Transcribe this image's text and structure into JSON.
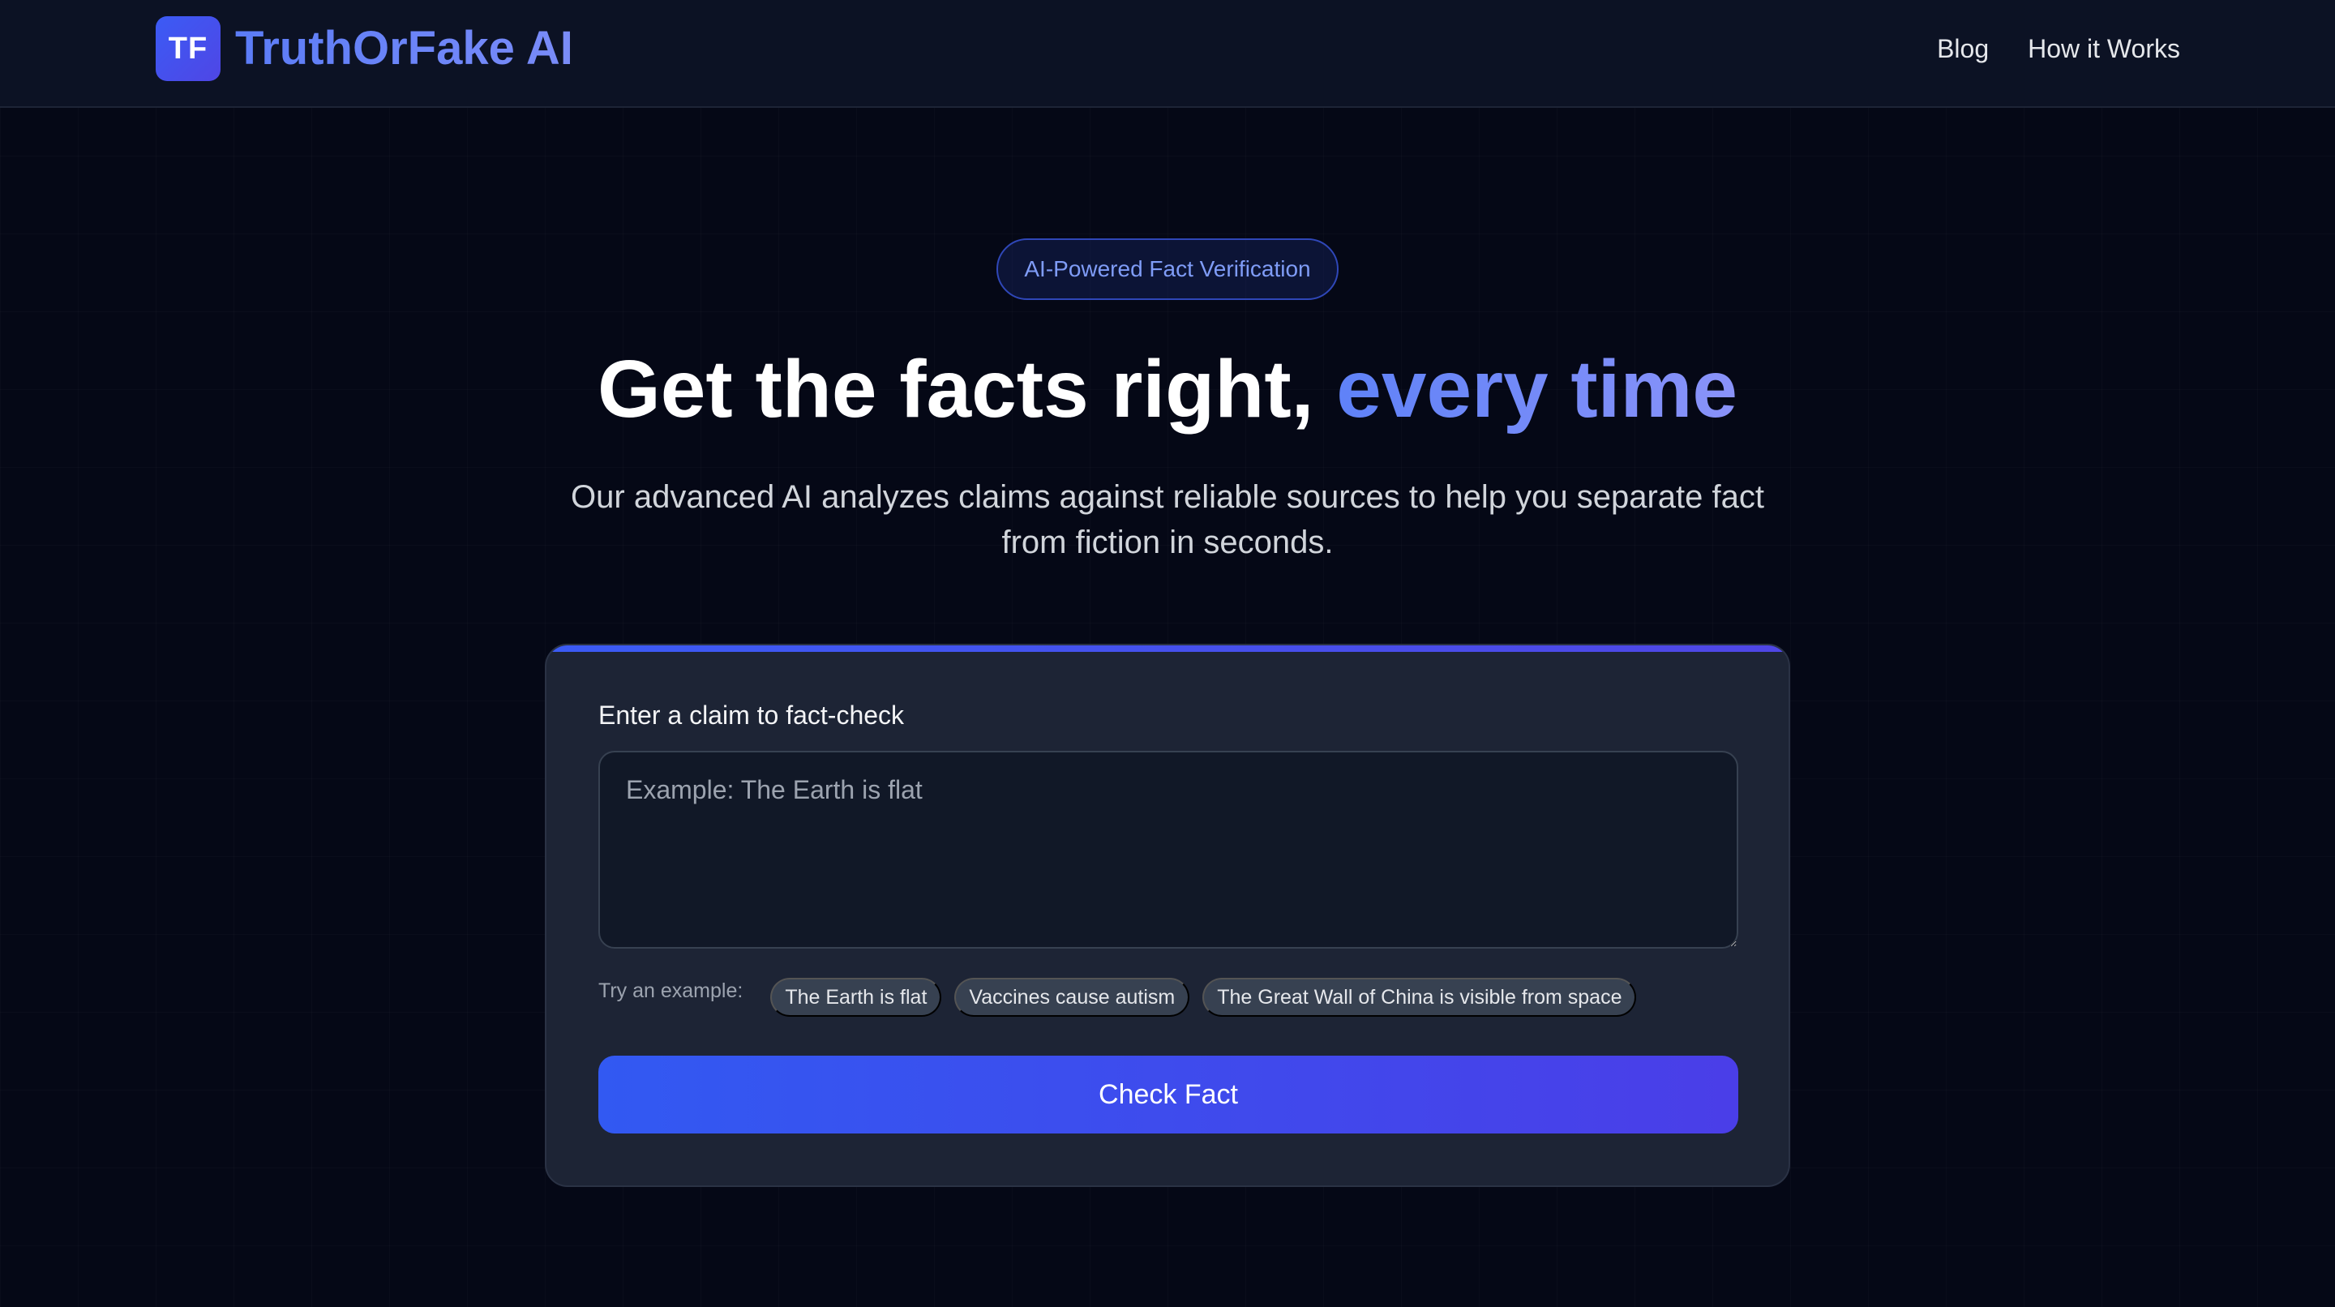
{
  "header": {
    "logo_text": "TF",
    "brand_name": "TruthOrFake AI",
    "nav": [
      {
        "label": "Blog"
      },
      {
        "label": "How it Works"
      }
    ]
  },
  "hero": {
    "badge": "AI-Powered Fact Verification",
    "title_main": "Get the facts right, ",
    "title_accent": "every time",
    "subtitle": "Our advanced AI analyzes claims against reliable sources to help you separate fact from fiction in seconds."
  },
  "checker": {
    "label": "Enter a claim to fact-check",
    "input_value": "",
    "input_placeholder": "Example: The Earth is flat",
    "examples_label": "Try an example:",
    "examples": [
      "The Earth is flat",
      "Vaccines cause autism",
      "The Great Wall of China is visible from space"
    ],
    "submit_label": "Check Fact"
  },
  "colors": {
    "background": "#050816",
    "header": "#0c1224",
    "accent_start": "#3b5bf5",
    "accent_end": "#4f46e5",
    "card": "#1d2435"
  }
}
